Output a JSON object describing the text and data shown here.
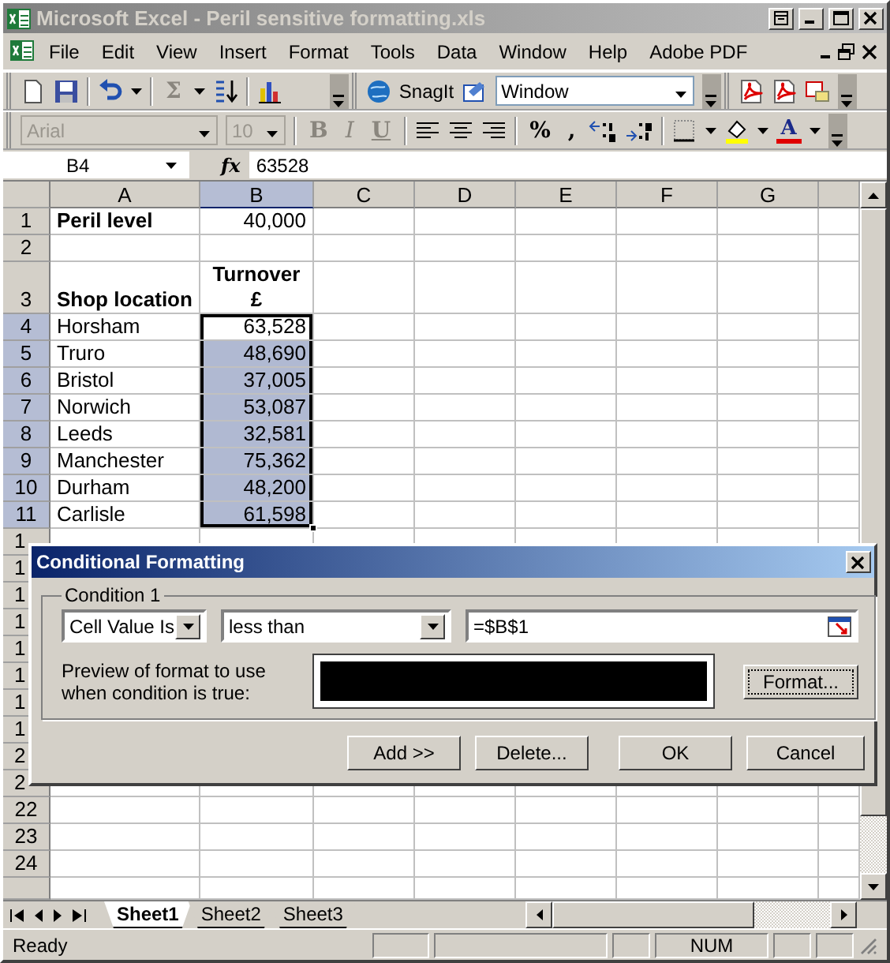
{
  "window": {
    "title": "Microsoft Excel - Peril sensitive formatting.xls"
  },
  "menu": {
    "items": [
      "File",
      "Edit",
      "View",
      "Insert",
      "Format",
      "Tools",
      "Data",
      "Window",
      "Help",
      "Adobe PDF"
    ]
  },
  "standard_toolbar": {
    "sum": "Σ",
    "snagit_label": "SnagIt",
    "snagit_profile": "Window"
  },
  "formatting_toolbar": {
    "font": {
      "value": "Arial",
      "disabled": true
    },
    "size": {
      "value": "10",
      "disabled": true
    },
    "bold": "B",
    "italic": "I",
    "underline": "U",
    "percent": "%",
    "comma": ",",
    "font_color": "A"
  },
  "formula_bar": {
    "name_box": "B4",
    "fx": "fx",
    "value": "63528"
  },
  "grid": {
    "columns": [
      {
        "label": "A",
        "selected": false
      },
      {
        "label": "B",
        "selected": true
      },
      {
        "label": "C",
        "selected": false
      },
      {
        "label": "D",
        "selected": false
      },
      {
        "label": "E",
        "selected": false
      },
      {
        "label": "F",
        "selected": false
      },
      {
        "label": "G",
        "selected": false
      }
    ],
    "rows": [
      {
        "label": "1",
        "selected": false,
        "cells": [
          {
            "text": "Peril level",
            "kind": "heading",
            "selected": false,
            "active": false
          },
          {
            "text": "40,000",
            "kind": "number",
            "selected": false,
            "active": false
          }
        ]
      },
      {
        "label": "2",
        "selected": false
      },
      {
        "label": "3",
        "selected": false,
        "cells": [
          {
            "text": "Shop location",
            "kind": "heading",
            "selected": false,
            "active": false
          },
          {
            "lines": [
              "Turnover",
              "£"
            ],
            "kind": "column-heading",
            "selected": false,
            "active": false
          }
        ]
      },
      {
        "label": "4",
        "selected": true,
        "cells": [
          {
            "text": "Horsham",
            "kind": "text",
            "selected": false,
            "active": false
          },
          {
            "text": "63,528",
            "kind": "number",
            "selected": true,
            "active": true
          }
        ]
      },
      {
        "label": "5",
        "selected": true,
        "cells": [
          {
            "text": "Truro",
            "kind": "text",
            "selected": false,
            "active": false
          },
          {
            "text": "48,690",
            "kind": "number",
            "selected": true,
            "active": false
          }
        ]
      },
      {
        "label": "6",
        "selected": true,
        "cells": [
          {
            "text": "Bristol",
            "kind": "text",
            "selected": false,
            "active": false
          },
          {
            "text": "37,005",
            "kind": "number",
            "selected": true,
            "active": false
          }
        ]
      },
      {
        "label": "7",
        "selected": true,
        "cells": [
          {
            "text": "Norwich",
            "kind": "text",
            "selected": false,
            "active": false
          },
          {
            "text": "53,087",
            "kind": "number",
            "selected": true,
            "active": false
          }
        ]
      },
      {
        "label": "8",
        "selected": true,
        "cells": [
          {
            "text": "Leeds",
            "kind": "text",
            "selected": false,
            "active": false
          },
          {
            "text": "32,581",
            "kind": "number",
            "selected": true,
            "active": false
          }
        ]
      },
      {
        "label": "9",
        "selected": true,
        "cells": [
          {
            "text": "Manchester",
            "kind": "text",
            "selected": false,
            "active": false
          },
          {
            "text": "75,362",
            "kind": "number",
            "selected": true,
            "active": false
          }
        ]
      },
      {
        "label": "10",
        "selected": true,
        "cells": [
          {
            "text": "Durham",
            "kind": "text",
            "selected": false,
            "active": false
          },
          {
            "text": "48,200",
            "kind": "number",
            "selected": true,
            "active": false
          }
        ]
      },
      {
        "label": "11",
        "selected": true,
        "cells": [
          {
            "text": "Carlisle",
            "kind": "text",
            "selected": false,
            "active": false
          },
          {
            "text": "61,598",
            "kind": "number",
            "selected": true,
            "active": false
          }
        ]
      },
      {
        "label": "1",
        "selected": false
      },
      {
        "label": "1",
        "selected": false
      },
      {
        "label": "1",
        "selected": false
      },
      {
        "label": "1",
        "selected": false
      },
      {
        "label": "1",
        "selected": false
      },
      {
        "label": "1",
        "selected": false
      },
      {
        "label": "1",
        "selected": false
      },
      {
        "label": "1",
        "selected": false
      },
      {
        "label": "2",
        "selected": false
      },
      {
        "label": "2",
        "selected": false
      },
      {
        "label": "22",
        "selected": false
      },
      {
        "label": "23",
        "selected": false
      },
      {
        "label": "24",
        "selected": false
      }
    ]
  },
  "dialog": {
    "title": "Conditional Formatting",
    "group_label": "Condition 1",
    "condition_type": "Cell Value Is",
    "operator": "less than",
    "value": "=$B$1",
    "preview_label": [
      "Preview of format to use",
      "when condition is true:"
    ],
    "format_button": "Format...",
    "buttons": [
      "Add >>",
      "Delete...",
      "OK",
      "Cancel"
    ]
  },
  "sheet_tabs": [
    {
      "label": "Sheet1",
      "selected": true
    },
    {
      "label": "Sheet2",
      "selected": false
    },
    {
      "label": "Sheet3",
      "selected": false
    }
  ],
  "status_bar": {
    "text": "Ready",
    "indicators": [
      "NUM"
    ]
  }
}
